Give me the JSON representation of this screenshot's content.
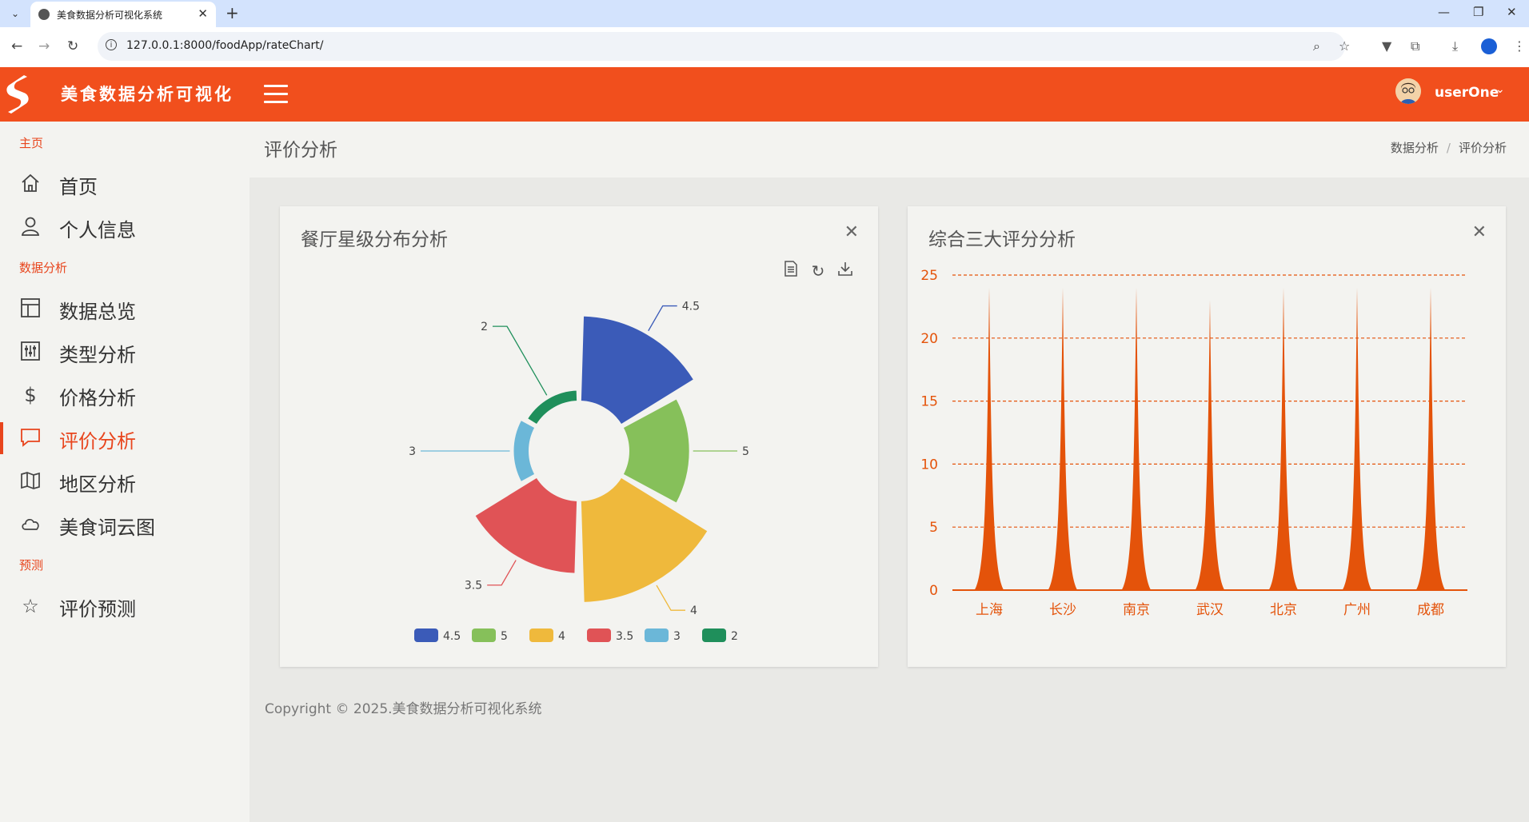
{
  "browser": {
    "tab_title": "美食数据分析可视化系统",
    "url": "127.0.0.1:8000/foodApp/rateChart/"
  },
  "header": {
    "app_title": "美食数据分析可视化",
    "username": "userOne"
  },
  "sidebar": {
    "sections": [
      {
        "label": "主页"
      },
      {
        "label": "数据分析"
      },
      {
        "label": "预测"
      }
    ],
    "items": [
      {
        "label": "首页",
        "icon": "home-icon"
      },
      {
        "label": "个人信息",
        "icon": "user-icon"
      },
      {
        "label": "数据总览",
        "icon": "layout-icon"
      },
      {
        "label": "类型分析",
        "icon": "sliders-icon"
      },
      {
        "label": "价格分析",
        "icon": "dollar-icon"
      },
      {
        "label": "评价分析",
        "icon": "comment-icon",
        "active": true
      },
      {
        "label": "地区分析",
        "icon": "map-icon"
      },
      {
        "label": "美食词云图",
        "icon": "cloud-icon"
      },
      {
        "label": "评价预测",
        "icon": "star-icon"
      }
    ]
  },
  "page": {
    "title": "评价分析",
    "breadcrumb": [
      "数据分析",
      "评价分析"
    ]
  },
  "cards": {
    "rose": {
      "title": "餐厅星级分布分析"
    },
    "area": {
      "title": "综合三大评分分析"
    }
  },
  "footer": {
    "text": "Copyright © 2025.美食数据分析可视化系统"
  },
  "colors": {
    "accent": "#f14f1d",
    "area_fill": "#e4530a"
  },
  "chart_data": [
    {
      "type": "pie",
      "subtype": "rose",
      "title": "餐厅星级分布分析",
      "legend_position": "bottom",
      "slices": [
        {
          "name": "4.5",
          "value": 55,
          "color": "#3b5bb8"
        },
        {
          "name": "5",
          "value": 28,
          "color": "#86c05a"
        },
        {
          "name": "4",
          "value": 78,
          "color": "#efb93c"
        },
        {
          "name": "3.5",
          "value": 40,
          "color": "#e05356"
        },
        {
          "name": "3",
          "value": 2,
          "color": "#6bb7d8"
        },
        {
          "name": "2",
          "value": 1,
          "color": "#1f8f5b"
        }
      ]
    },
    {
      "type": "area",
      "title": "综合三大评分分析",
      "categories": [
        "上海",
        "长沙",
        "南京",
        "武汉",
        "北京",
        "广州",
        "成都"
      ],
      "values": [
        24,
        24,
        24,
        23,
        24,
        24,
        24
      ],
      "ylim": [
        0,
        25
      ],
      "yticks": [
        0,
        5,
        10,
        15,
        20,
        25
      ],
      "grid": true
    }
  ]
}
